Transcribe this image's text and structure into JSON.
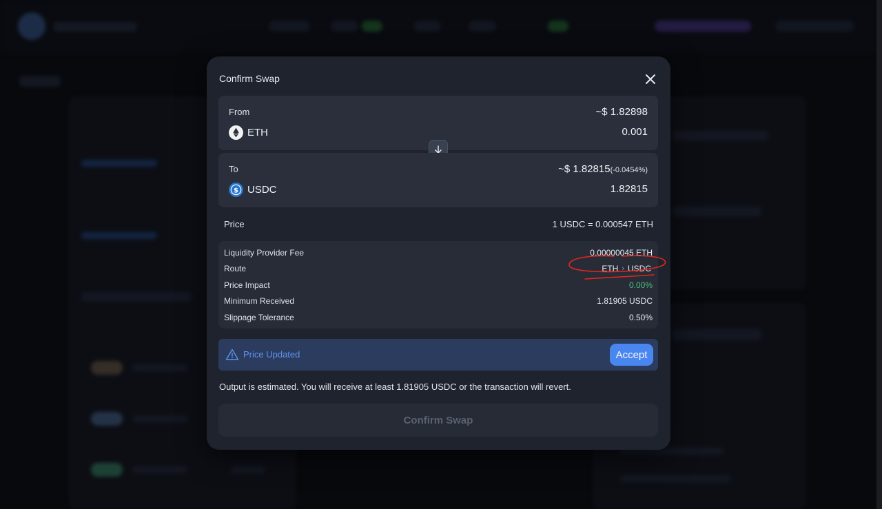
{
  "modal": {
    "title": "Confirm Swap"
  },
  "from": {
    "label": "From",
    "usd_value": "~$ 1.82898",
    "token": "ETH",
    "amount": "0.001"
  },
  "to": {
    "label": "To",
    "usd_value": "~$ 1.82815",
    "usd_delta": "(-0.0454%)",
    "token": "USDC",
    "amount": "1.82815"
  },
  "price": {
    "label": "Price",
    "value": "1 USDC = 0.000547 ETH"
  },
  "details": {
    "lp_fee_label": "Liquidity Provider Fee",
    "lp_fee_value": "0.00000045 ETH",
    "route_label": "Route",
    "route_from": "ETH",
    "route_separator": "›",
    "route_to": "USDC",
    "price_impact_label": "Price Impact",
    "price_impact_value": "0.00%",
    "min_received_label": "Minimum Received",
    "min_received_value": "1.81905 USDC",
    "slippage_label": "Slippage Tolerance",
    "slippage_value": "0.50%"
  },
  "price_update": {
    "text": "Price Updated",
    "accept_label": "Accept"
  },
  "estimate_note": "Output is estimated. You will receive at least 1.81905 USDC or the transaction will revert.",
  "confirm_button": "Confirm Swap",
  "icons": {
    "close": "close-icon",
    "swap_direction": "arrow-down-icon",
    "eth": "eth-icon",
    "usdc": "usdc-icon",
    "warning": "warning-triangle-icon"
  },
  "colors": {
    "accent": "#4a86ef",
    "positive": "#4cc07f",
    "warning_bg": "#2c3c5e",
    "annotation": "#e0271f"
  }
}
